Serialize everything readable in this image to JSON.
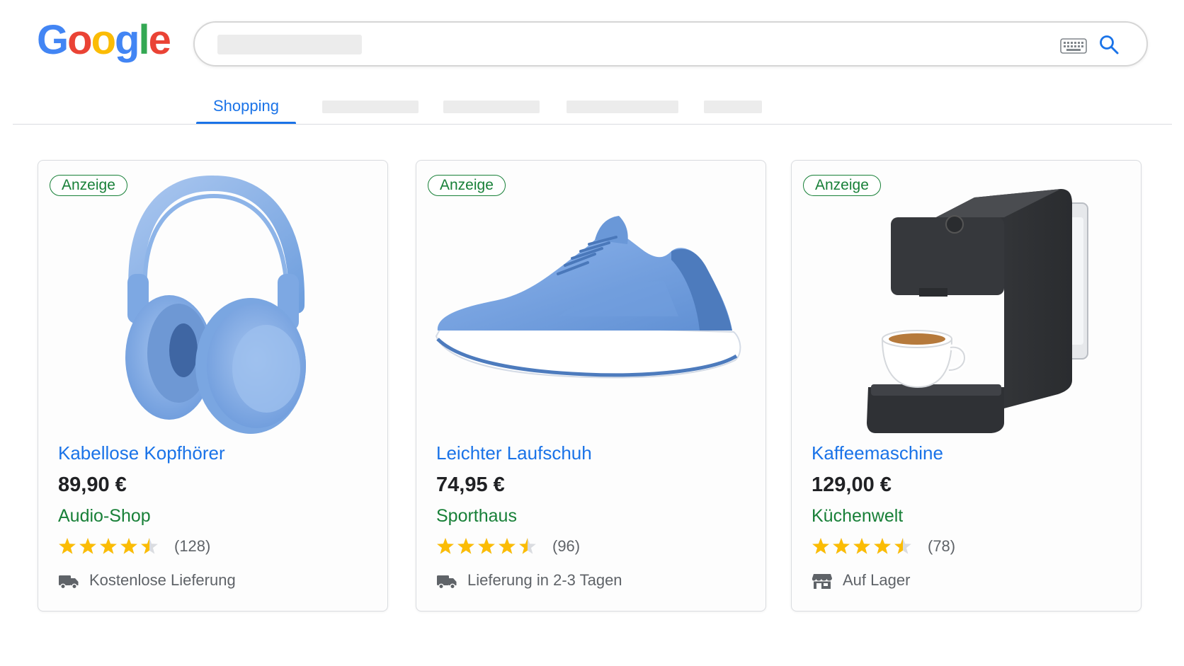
{
  "logo": {
    "letters": [
      "G",
      "o",
      "o",
      "g",
      "l",
      "e"
    ],
    "colors": [
      "#4285F4",
      "#EA4335",
      "#FBBC05",
      "#4285F4",
      "#34A853",
      "#EA4335"
    ]
  },
  "search": {
    "value": ""
  },
  "tabs": {
    "active_label": "Shopping"
  },
  "colors": {
    "link": "#1a73e8",
    "ad_green": "#188038",
    "star": "#FBBC04"
  },
  "products": [
    {
      "badge": "Anzeige",
      "image_icon": "headphones-image",
      "title": "Kabellose Kopfhörer",
      "price": "89,90 €",
      "shop": "Audio-Shop",
      "rating": 4.5,
      "rating_count": "(128)",
      "delivery_icon": "truck-icon",
      "delivery": "Kostenlose Lieferung"
    },
    {
      "badge": "Anzeige",
      "image_icon": "running-shoe-image",
      "title": "Leichter Laufschuh",
      "price": "74,95 €",
      "shop": "Sporthaus",
      "rating": 4.5,
      "rating_count": "(96)",
      "delivery_icon": "truck-icon",
      "delivery": "Lieferung in 2-3 Tagen"
    },
    {
      "badge": "Anzeige",
      "image_icon": "coffee-machine-image",
      "title": "Kaffeemaschine",
      "price": "129,00 €",
      "shop": "Küchenwelt",
      "rating": 4.5,
      "rating_count": "(78)",
      "delivery_icon": "store-icon",
      "delivery": "Auf Lager"
    }
  ]
}
